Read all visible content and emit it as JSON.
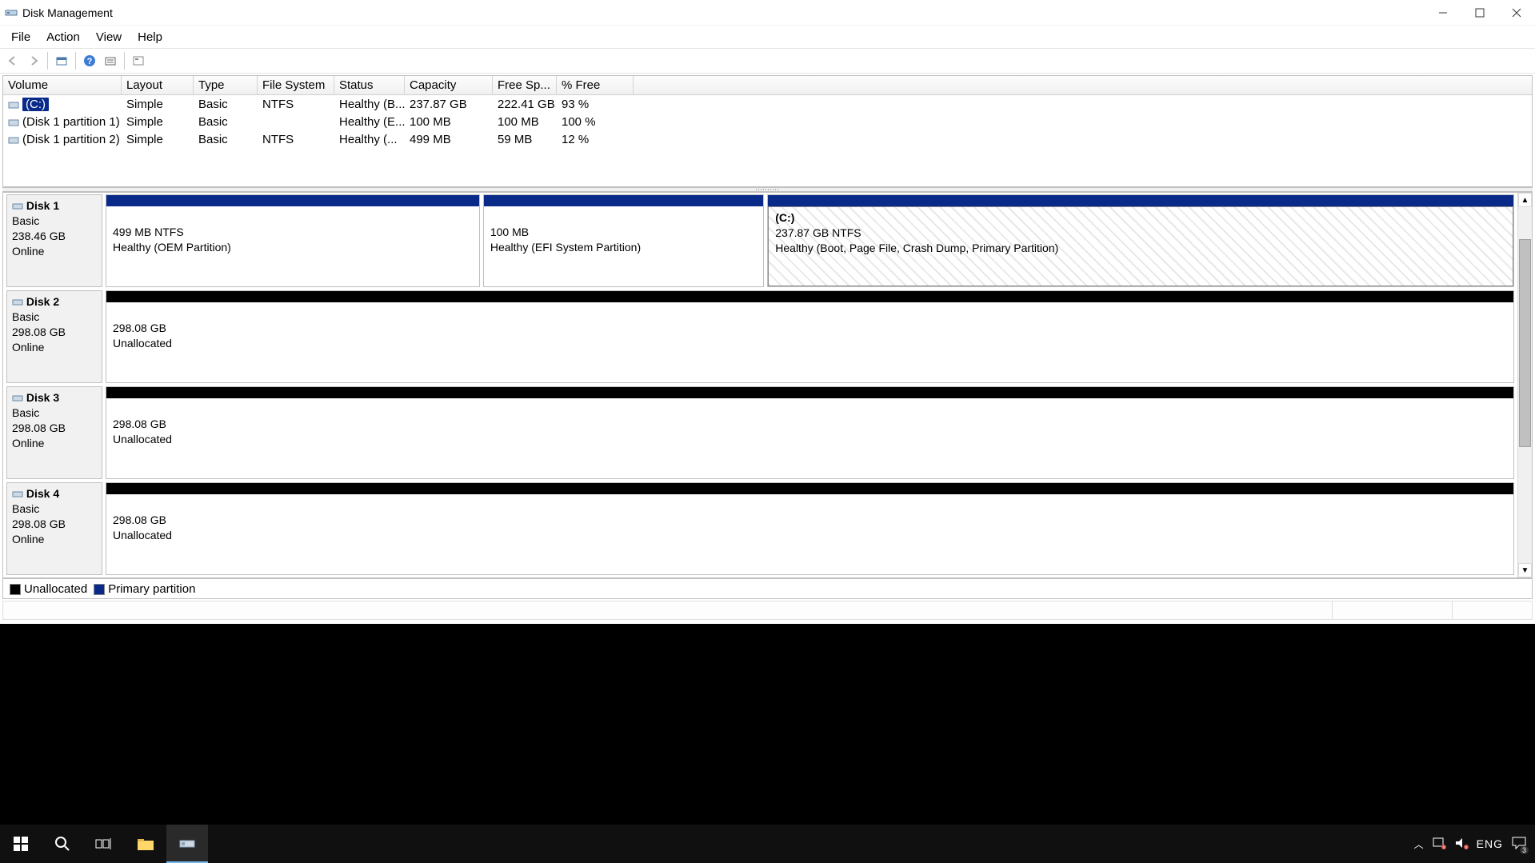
{
  "window": {
    "title": "Disk Management"
  },
  "menus": [
    "File",
    "Action",
    "View",
    "Help"
  ],
  "volume_table": {
    "columns": [
      "Volume",
      "Layout",
      "Type",
      "File System",
      "Status",
      "Capacity",
      "Free Sp...",
      "% Free"
    ],
    "rows": [
      {
        "name": "(C:)",
        "layout": "Simple",
        "type": "Basic",
        "fs": "NTFS",
        "status": "Healthy (B...",
        "capacity": "237.87 GB",
        "free": "222.41 GB",
        "pct": "93 %",
        "selected": true
      },
      {
        "name": "(Disk 1 partition 1)",
        "layout": "Simple",
        "type": "Basic",
        "fs": "",
        "status": "Healthy (E...",
        "capacity": "100 MB",
        "free": "100 MB",
        "pct": "100 %",
        "selected": false
      },
      {
        "name": "(Disk 1 partition 2)",
        "layout": "Simple",
        "type": "Basic",
        "fs": "NTFS",
        "status": "Healthy (...",
        "capacity": "499 MB",
        "free": "59 MB",
        "pct": "12 %",
        "selected": false
      }
    ]
  },
  "disks": [
    {
      "name": "Disk 1",
      "type": "Basic",
      "size": "238.46 GB",
      "state": "Online",
      "partitions": [
        {
          "kind": "primary",
          "title": "",
          "line1": "499 MB NTFS",
          "line2": "Healthy (OEM Partition)",
          "flex": 24,
          "selected": false
        },
        {
          "kind": "primary",
          "title": "",
          "line1": "100 MB",
          "line2": "Healthy (EFI System Partition)",
          "flex": 18,
          "selected": false
        },
        {
          "kind": "primary",
          "title": "(C:)",
          "line1": "237.87 GB NTFS",
          "line2": "Healthy (Boot, Page File, Crash Dump, Primary Partition)",
          "flex": 48,
          "selected": true
        }
      ]
    },
    {
      "name": "Disk 2",
      "type": "Basic",
      "size": "298.08 GB",
      "state": "Online",
      "partitions": [
        {
          "kind": "unalloc",
          "title": "",
          "line1": "298.08 GB",
          "line2": "Unallocated",
          "flex": 100,
          "selected": false
        }
      ]
    },
    {
      "name": "Disk 3",
      "type": "Basic",
      "size": "298.08 GB",
      "state": "Online",
      "partitions": [
        {
          "kind": "unalloc",
          "title": "",
          "line1": "298.08 GB",
          "line2": "Unallocated",
          "flex": 100,
          "selected": false
        }
      ]
    },
    {
      "name": "Disk 4",
      "type": "Basic",
      "size": "298.08 GB",
      "state": "Online",
      "partitions": [
        {
          "kind": "unalloc",
          "title": "",
          "line1": "298.08 GB",
          "line2": "Unallocated",
          "flex": 100,
          "selected": false
        }
      ]
    }
  ],
  "legend": {
    "unallocated": "Unallocated",
    "primary": "Primary partition"
  },
  "taskbar": {
    "language": "ENG",
    "notification_count": "3"
  }
}
